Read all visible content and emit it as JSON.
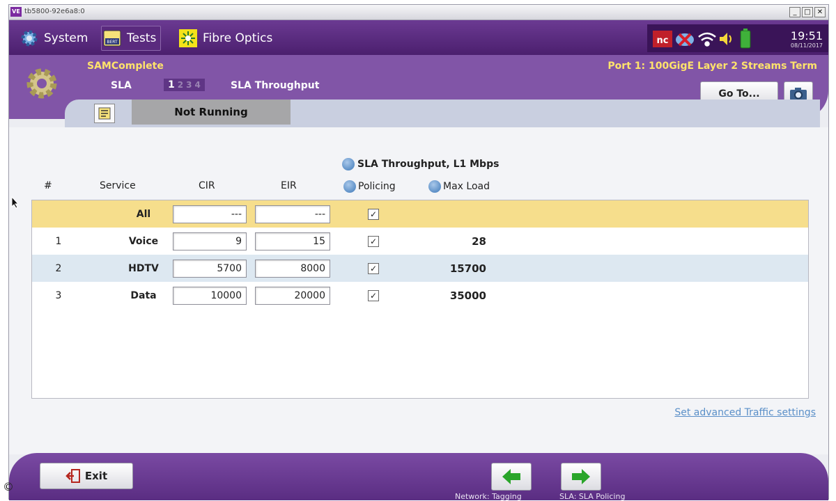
{
  "window": {
    "title": "tb5800-92e6a8:0",
    "app_icon": "VE"
  },
  "nav": {
    "system_label": "System",
    "tests_label": "Tests",
    "tests_badge": "BERT",
    "fibre_label": "Fibre Optics",
    "time": "19:51",
    "date": "08/11/2017"
  },
  "header": {
    "app_name": "SAMComplete",
    "port": "Port 1: 100GigE Layer 2 Streams Term",
    "section": "SLA",
    "steps": [
      "1",
      "2",
      "3",
      "4"
    ],
    "current_step": "1",
    "step_name": "SLA Throughput",
    "goto_label": "Go To..."
  },
  "status": {
    "run_state": "Not Running"
  },
  "table": {
    "title": "SLA Throughput, L1 Mbps",
    "headers": {
      "num": "#",
      "service": "Service",
      "cir": "CIR",
      "eir": "EIR",
      "policing": "Policing",
      "max_load": "Max Load"
    },
    "rows": [
      {
        "num": "",
        "service": "All",
        "cir": "---",
        "eir": "---",
        "policing": true,
        "max_load": ""
      },
      {
        "num": "1",
        "service": "Voice",
        "cir": "9",
        "eir": "15",
        "policing": true,
        "max_load": "28"
      },
      {
        "num": "2",
        "service": "HDTV",
        "cir": "5700",
        "eir": "8000",
        "policing": true,
        "max_load": "15700"
      },
      {
        "num": "3",
        "service": "Data",
        "cir": "10000",
        "eir": "20000",
        "policing": true,
        "max_load": "35000"
      }
    ]
  },
  "advanced_link": "Set advanced Traffic settings",
  "footer": {
    "exit_label": "Exit",
    "prev_label": "Network: Tagging",
    "next_label": "SLA: SLA Policing"
  },
  "copyright": "©",
  "colors": {
    "purple": "#8155a7",
    "dark_purple": "#4b1f6e",
    "highlight_row": "#f6de8c",
    "alt_row": "#dde8f1",
    "accent_yellow": "#ffe36b"
  }
}
